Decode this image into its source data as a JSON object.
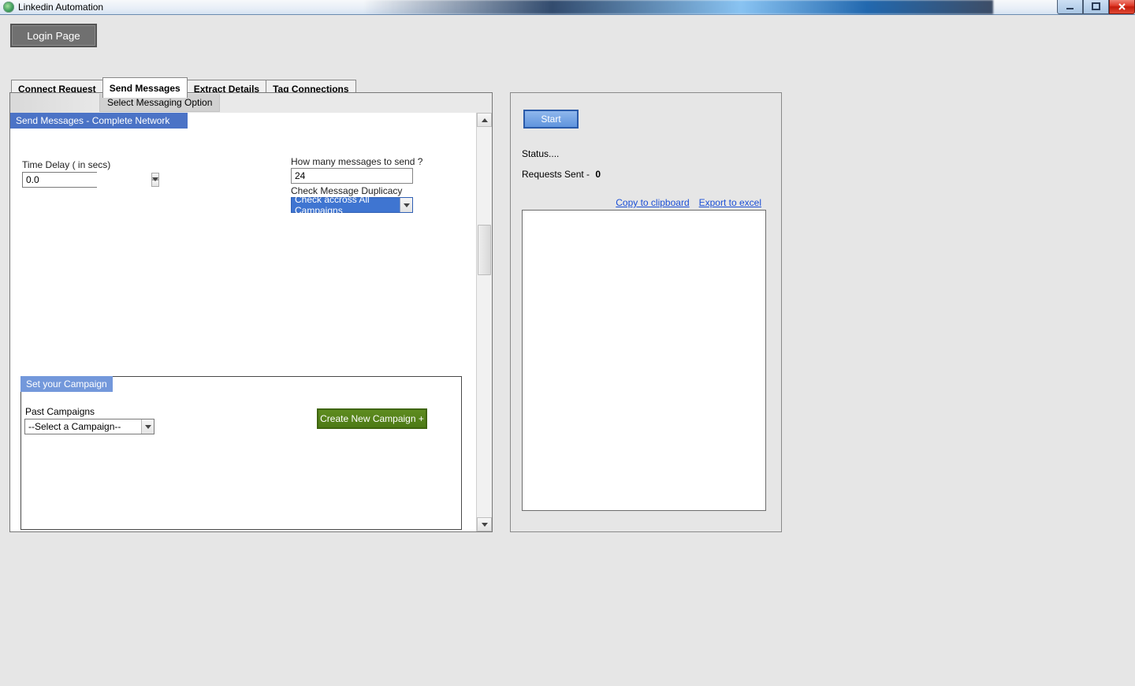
{
  "window": {
    "title": "Linkedin Automation"
  },
  "toolbar": {
    "login_label": "Login Page"
  },
  "tabs": {
    "connect": "Connect Request",
    "send": "Send Messages",
    "extract": "Extract Details",
    "tag": "Tag Connections"
  },
  "main": {
    "messaging_option_label": "Select Messaging Option",
    "section_header": "Send Messages - Complete Network",
    "time_delay_label": "Time Delay ( in secs)",
    "time_delay_value": "0.0",
    "msg_count_label": "How many messages to send ?",
    "msg_count_value": "24",
    "duplicacy_label": "Check Message Duplicacy",
    "duplicacy_value": "Check accross All Campaigns",
    "campaign": {
      "header": "Set your Campaign",
      "past_label": "Past Campaigns",
      "past_value": "--Select a Campaign--",
      "create_label": "Create New Campaign +"
    }
  },
  "right": {
    "start_label": "Start",
    "status_label": "Status....",
    "sent_label": "Requests Sent -",
    "sent_value": "0",
    "copy_link": "Copy to clipboard",
    "export_link": "Export to excel"
  }
}
